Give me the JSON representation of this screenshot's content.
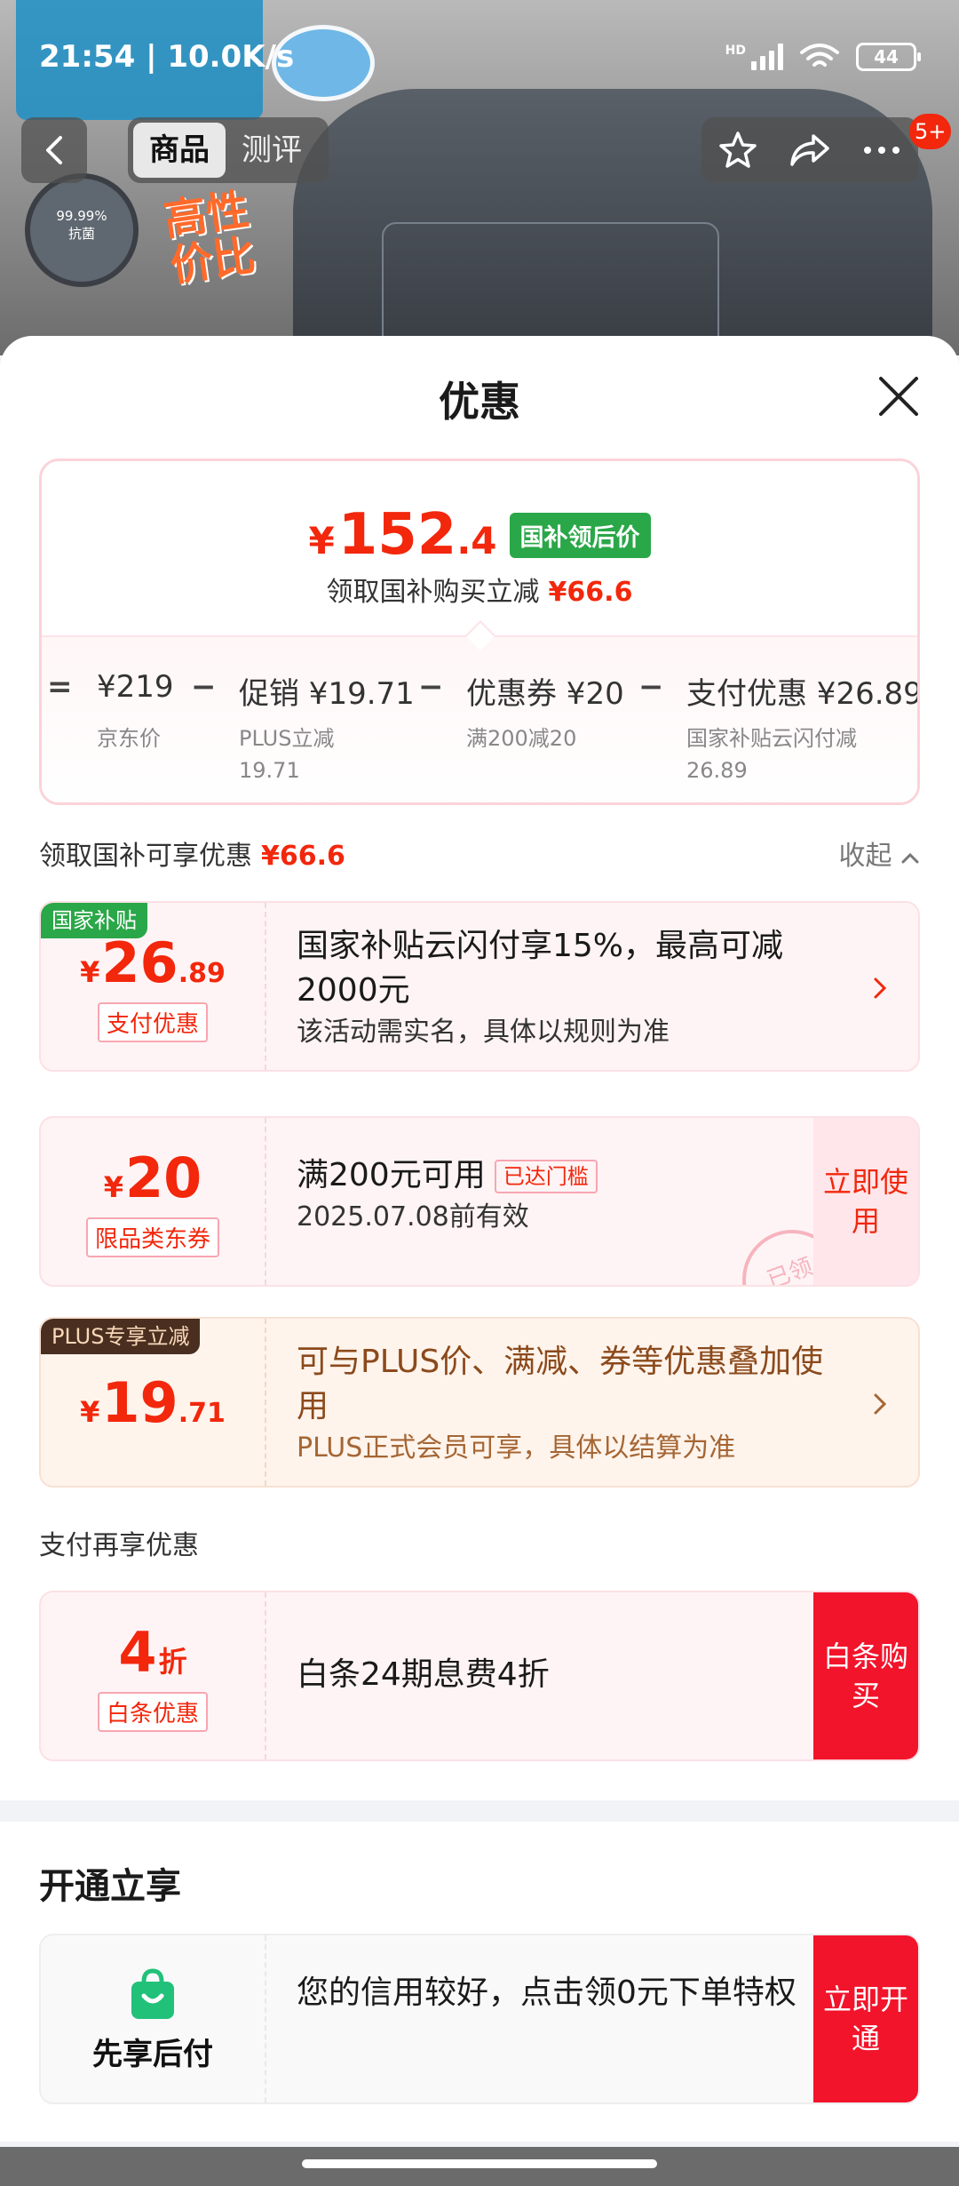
{
  "status_bar": {
    "time": "21:54 | 10.0K/s",
    "network": "HD",
    "battery": "44"
  },
  "product_nav": {
    "tabs": [
      {
        "label": "商品",
        "active": true
      },
      {
        "label": "测评",
        "active": false
      }
    ],
    "cart_badge": "5+",
    "icons": [
      "back-icon",
      "star-icon",
      "share-icon",
      "more-icon"
    ]
  },
  "backdrop": {
    "antibac_line1": "99.99%",
    "antibac_line2": "抗菌",
    "slogan": "高性价比"
  },
  "sheet": {
    "title": "优惠",
    "summary": {
      "yen": "¥",
      "price_int": "152",
      "price_dec": ".4",
      "tag": "国补领后价",
      "sub_text": "领取国补购买立减",
      "sub_amount": "¥66.6",
      "formula": {
        "eq": "=",
        "minus": "−",
        "items": [
          {
            "value": "¥219",
            "note": "京东价"
          },
          {
            "value": "促销 ¥19.71",
            "note": "PLUS立减\n19.71"
          },
          {
            "value": "优惠券 ¥20",
            "note": "满200减20"
          },
          {
            "value": "支付优惠 ¥26.89",
            "note": "国家补贴云闪付减\n26.89"
          }
        ]
      }
    },
    "section_label": "领取国补可享优惠",
    "section_amount": "¥66.6",
    "collapse_label": "收起",
    "cards": [
      {
        "corner": "国家补贴",
        "yen": "¥",
        "int": "26",
        "dec": ".89",
        "tag": "支付优惠",
        "title": "国家补贴云闪付享15%，最高可减2000元",
        "desc": "该活动需实名，具体以规则为准"
      },
      {
        "yen": "¥",
        "int": "20",
        "tag": "限品类东券",
        "title": "满200元可用",
        "title_tag": "已达门槛",
        "desc": "2025.07.08前有效",
        "button": "立即使用",
        "stamp": "已领"
      },
      {
        "corner": "PLUS专享立减",
        "yen": "¥",
        "int": "19",
        "dec": ".71",
        "title": "可与PLUS价、满减、券等优惠叠加使用",
        "desc": "PLUS正式会员可享，具体以结算为准"
      }
    ],
    "pay_section_label": "支付再享优惠",
    "pay_card": {
      "int": "4",
      "unit": "折",
      "tag": "白条优惠",
      "title": "白条24期息费4折",
      "button": "白条购买"
    }
  },
  "open_section": {
    "title": "开通立享",
    "card": {
      "name": "先享后付",
      "title": "您的信用较好，点击领0元下单特权",
      "button": "立即开通"
    }
  },
  "colors": {
    "accent": "#f2270c",
    "green": "#2aa748",
    "button_red": "#f2142b"
  }
}
